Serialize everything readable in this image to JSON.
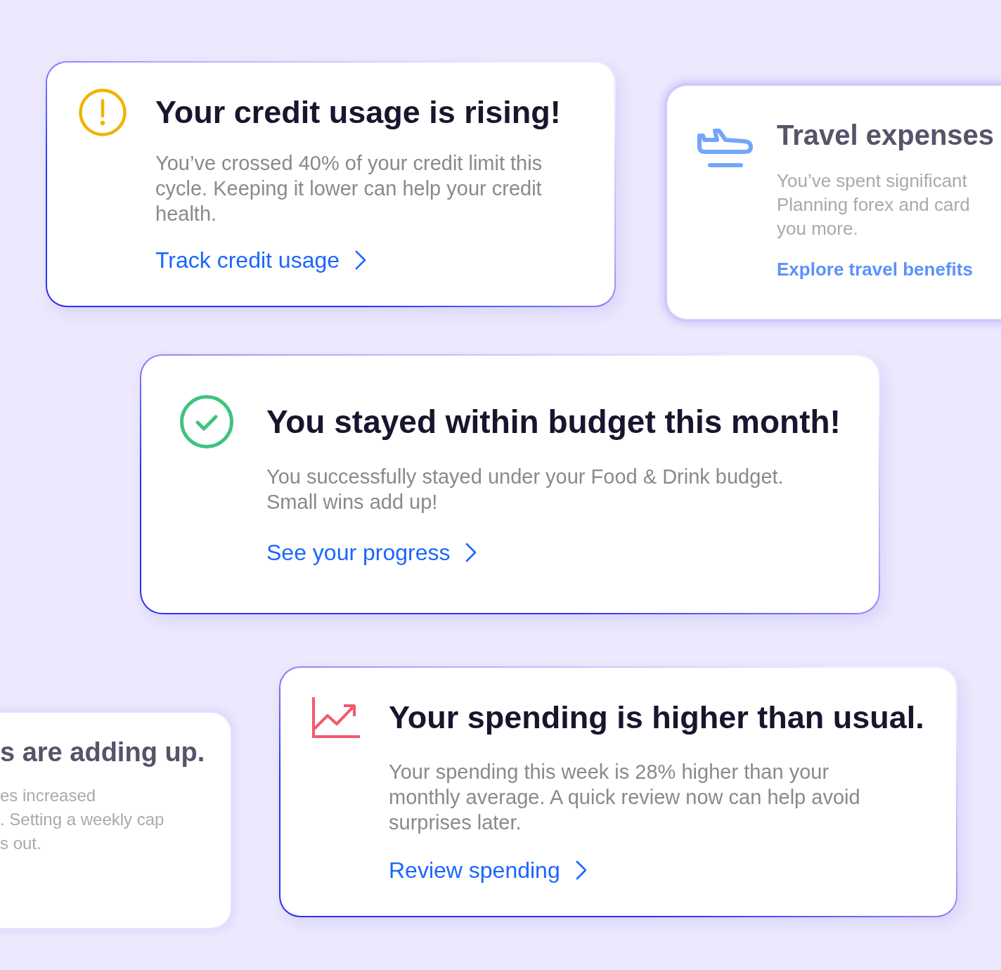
{
  "cards": [
    {
      "kind": "warning",
      "blurred": false,
      "title": "Your credit usage is rising!",
      "body": "You’ve crossed 40% of your credit limit this cycle. Keeping it lower can help your credit health.",
      "link": "Track credit usage"
    },
    {
      "kind": "travel",
      "blurred": true,
      "title": "Travel expenses",
      "body_lines": [
        "You’ve spent significant",
        "Planning forex and card",
        "you more."
      ],
      "link": "Explore travel benefits"
    },
    {
      "kind": "success",
      "blurred": false,
      "title": "You stayed within budget this month!",
      "body": "You successfully stayed under your Food & Drink budget. Small wins add up!",
      "link": "See your progress"
    },
    {
      "kind": "plain",
      "blurred": true,
      "title": "s are adding up.",
      "body_lines": [
        "es increased",
        ". Setting a weekly cap",
        "s out."
      ]
    },
    {
      "kind": "trend",
      "blurred": false,
      "title": "Your spending is higher than usual.",
      "body": "Your spending this week is 28% higher than your monthly average. A quick review now can help avoid surprises later.",
      "link": "Review spending"
    }
  ]
}
